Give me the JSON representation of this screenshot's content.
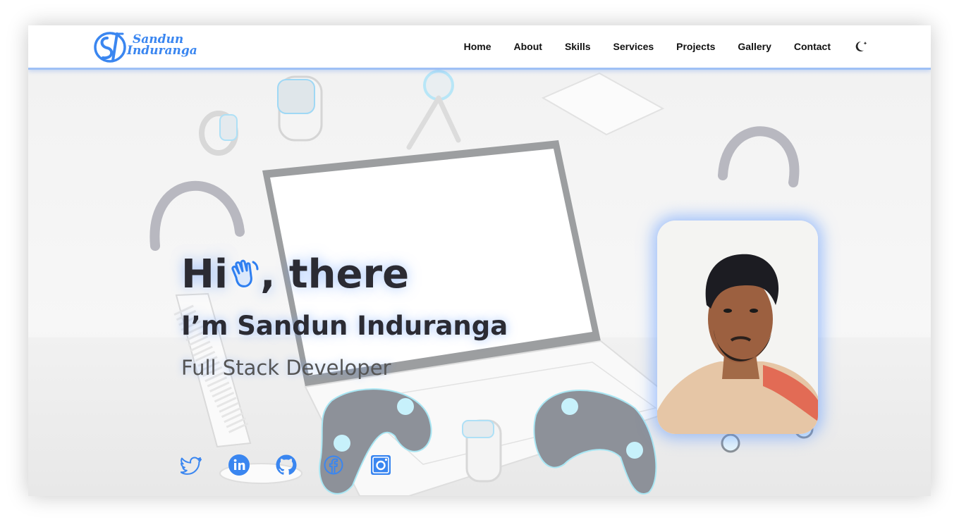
{
  "brand": {
    "logo_monogram": "SI",
    "logo_line1": "Sandun",
    "logo_line2": "Induranga",
    "accent_color": "#3a86f0"
  },
  "nav": {
    "items": [
      "Home",
      "About",
      "Skills",
      "Services",
      "Projects",
      "Gallery",
      "Contact"
    ],
    "theme_toggle_icon": "moon-icon"
  },
  "hero": {
    "greeting_before": "Hi",
    "greeting_after": ", there",
    "greeting_icon": "waving-hand-icon",
    "name": "I’m Sandun Induranga",
    "role": "Full Stack Developer",
    "photo_icon": "profile-photo",
    "background": "3d-gadgets-laptop-scene"
  },
  "socials": [
    "twitter-icon",
    "linkedin-icon",
    "github-icon",
    "facebook-icon",
    "instagram-icon"
  ]
}
